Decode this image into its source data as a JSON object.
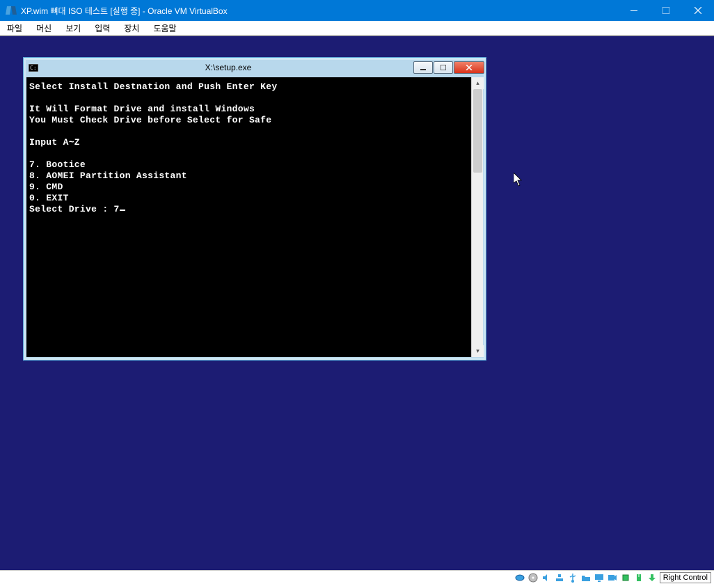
{
  "vbox": {
    "title": "XP.wim 뼈대 ISO 테스트 [실행 중] - Oracle VM VirtualBox",
    "menu": {
      "file": "파일",
      "machine": "머신",
      "view": "보기",
      "input": "입력",
      "devices": "장치",
      "help": "도움말"
    },
    "status": {
      "host_key": "Right Control"
    }
  },
  "console": {
    "title": "X:\\setup.exe",
    "lines": {
      "l01": "Select Install Destnation and Push Enter Key",
      "l02": "",
      "l03": "It Will Format Drive and install Windows",
      "l04": "You Must Check Drive before Select for Safe",
      "l05": "",
      "l06": "Input A~Z",
      "l07": "",
      "l08": "7. Bootice",
      "l09": "8. AOMEI Partition Assistant",
      "l10": "9. CMD",
      "l11": "0. EXIT",
      "l12": "Select Drive : 7"
    }
  }
}
